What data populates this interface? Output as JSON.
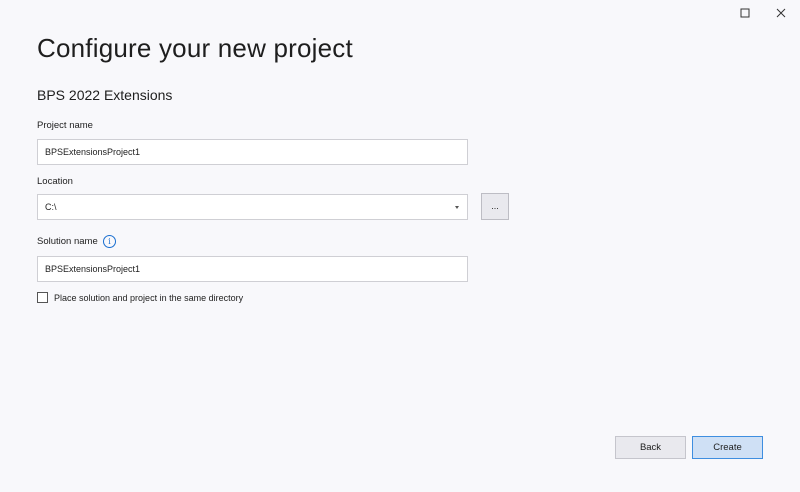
{
  "window": {
    "maximize_icon": "maximize-icon",
    "close_icon": "close-icon"
  },
  "header": {
    "title": "Configure your new project",
    "template_name": "BPS 2022 Extensions"
  },
  "form": {
    "project_name": {
      "label": "Project name",
      "value": "BPSExtensionsProject1"
    },
    "location": {
      "label": "Location",
      "value": "C:\\",
      "browse_label": "..."
    },
    "solution_name": {
      "label": "Solution name",
      "info_glyph": "i",
      "value": "BPSExtensionsProject1"
    },
    "same_directory": {
      "label": "Place solution and project in the same directory",
      "checked": false
    }
  },
  "footer": {
    "back_label": "Back",
    "create_label": "Create"
  },
  "colors": {
    "background": "#f8f8fb",
    "accent": "#1a6fd0",
    "primary_button_bg": "#cfe0f5",
    "primary_button_border": "#3e8ee0"
  }
}
